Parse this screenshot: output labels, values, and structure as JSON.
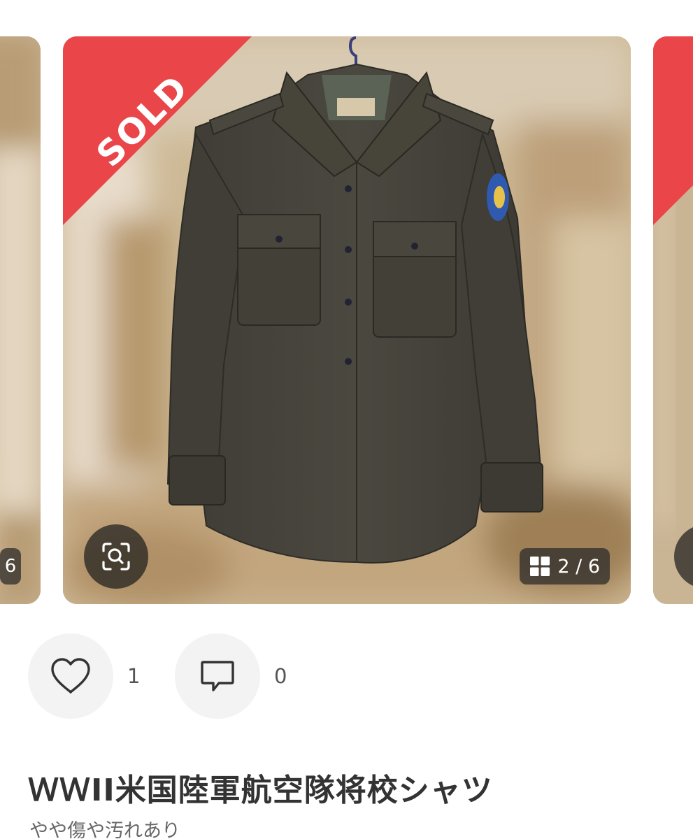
{
  "carousel": {
    "sold_label": "SOLD",
    "counter": "2 / 6",
    "prev_counter": "6",
    "icons": {
      "zoom": "zoom-scan-icon",
      "gallery": "grid-icon"
    }
  },
  "actions": {
    "like_count": "1",
    "comment_count": "0",
    "icons": {
      "like": "heart-icon",
      "comment": "comment-icon"
    }
  },
  "item": {
    "title": "ＷＷII米国陸軍航空隊将校シャツ",
    "condition": "やや傷や汚れあり"
  },
  "colors": {
    "sold_ribbon": "#ea4649",
    "background": "#ffffff",
    "action_button_bg": "#f3f3f3",
    "title_text": "#333333"
  }
}
